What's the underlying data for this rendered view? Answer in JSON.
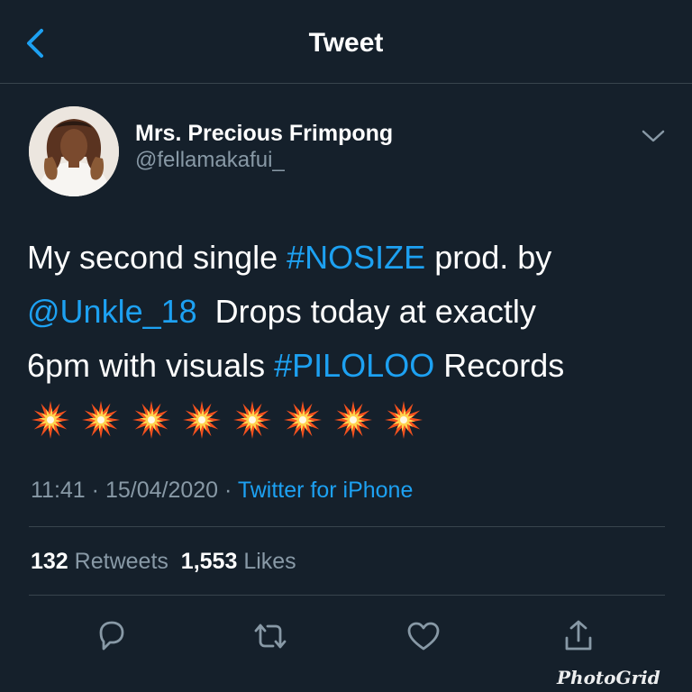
{
  "header": {
    "title": "Tweet",
    "back_icon": "chevron-left-icon"
  },
  "author": {
    "display_name": "Mrs. Precious Frimpong",
    "handle": "@fellamakafui_"
  },
  "tweet": {
    "lines": [
      [
        {
          "text": "My second single ",
          "link": false
        },
        {
          "text": "#NOSIZE",
          "link": true
        },
        {
          "text": " prod. by",
          "link": false
        }
      ],
      [
        {
          "text": "@Unkle_18",
          "link": true
        },
        {
          "text": "  Drops today at exactly",
          "link": false
        }
      ],
      [
        {
          "text": "6pm with visuals ",
          "link": false
        },
        {
          "text": "#PILOLOO",
          "link": true
        },
        {
          "text": " Records",
          "link": false
        }
      ]
    ],
    "emoji": "💥",
    "emoji_count": 8
  },
  "meta": {
    "time": "11:41",
    "separator": " · ",
    "date": "15/04/2020",
    "source": "Twitter for iPhone"
  },
  "stats": {
    "retweets_count": "132",
    "retweets_label": "Retweets",
    "likes_count": "1,553",
    "likes_label": "Likes"
  },
  "actions": [
    "reply-icon",
    "retweet-icon",
    "like-icon",
    "share-icon"
  ],
  "watermark": "PhotoGrid",
  "colors": {
    "background": "#15202b",
    "accent": "#1da1f2",
    "secondary_text": "#8899a6",
    "divider": "#38444d"
  }
}
